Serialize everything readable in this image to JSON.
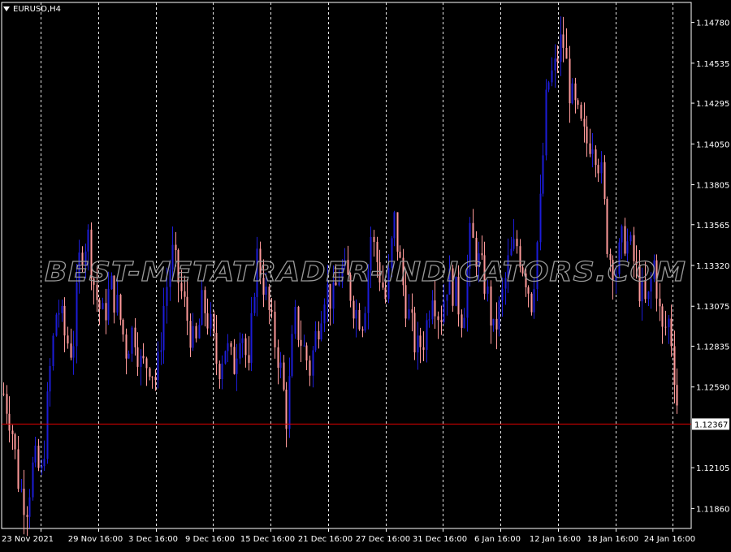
{
  "window": {
    "symbol_label": "EURUSD,H4"
  },
  "watermark": {
    "text": "BEST-METATRADER-INDICATORS.COM"
  },
  "colors": {
    "background": "#000000",
    "axis": "#ffffff",
    "grid": "#ffffff",
    "bull": "#1c1cd8",
    "bear": "#ff9a9a",
    "price_line": "#e00000"
  },
  "chart_data": {
    "type": "candlestick",
    "symbol": "EURUSD",
    "timeframe": "H4",
    "ylim": [
      1.1174,
      1.149
    ],
    "y_ticks": [
      "1.14780",
      "1.14535",
      "1.14295",
      "1.14050",
      "1.13805",
      "1.13565",
      "1.13320",
      "1.13075",
      "1.12835",
      "1.12590",
      "1.12105",
      "1.11860"
    ],
    "current_price": "1.12367",
    "x_ticks": [
      "23 Nov 2021",
      "29 Nov 16:00",
      "3 Dec 16:00",
      "9 Dec 16:00",
      "15 Dec 16:00",
      "21 Dec 16:00",
      "27 Dec 16:00",
      "31 Dec 16:00",
      "6 Jan 16:00",
      "12 Jan 16:00",
      "18 Jan 16:00",
      "24 Jan 16:00"
    ],
    "price_path": [
      1.1255,
      1.1238,
      1.12,
      1.1188,
      1.1215,
      1.1205,
      1.1265,
      1.131,
      1.129,
      1.128,
      1.134,
      1.135,
      1.1315,
      1.13,
      1.132,
      1.1305,
      1.1282,
      1.1295,
      1.127,
      1.1275,
      1.1262,
      1.131,
      1.134,
      1.132,
      1.13,
      1.128,
      1.131,
      1.1295,
      1.127,
      1.1285,
      1.127,
      1.13,
      1.1265,
      1.134,
      1.132,
      1.1295,
      1.1275,
      1.124,
      1.13,
      1.1285,
      1.127,
      1.1295,
      1.132,
      1.131,
      1.133,
      1.1322,
      1.1305,
      1.13,
      1.135,
      1.133,
      1.131,
      1.136,
      1.1325,
      1.13,
      1.128,
      1.129,
      1.132,
      1.13,
      1.1325,
      1.1315,
      1.13,
      1.135,
      1.1335,
      1.132,
      1.129,
      1.131,
      1.1335,
      1.1345,
      1.133,
      1.131,
      1.136,
      1.144,
      1.145,
      1.147,
      1.1435,
      1.142,
      1.1405,
      1.141,
      1.139,
      1.134,
      1.133,
      1.135,
      1.134,
      1.132,
      1.1305,
      1.1335,
      1.129,
      1.13,
      1.125
    ]
  }
}
